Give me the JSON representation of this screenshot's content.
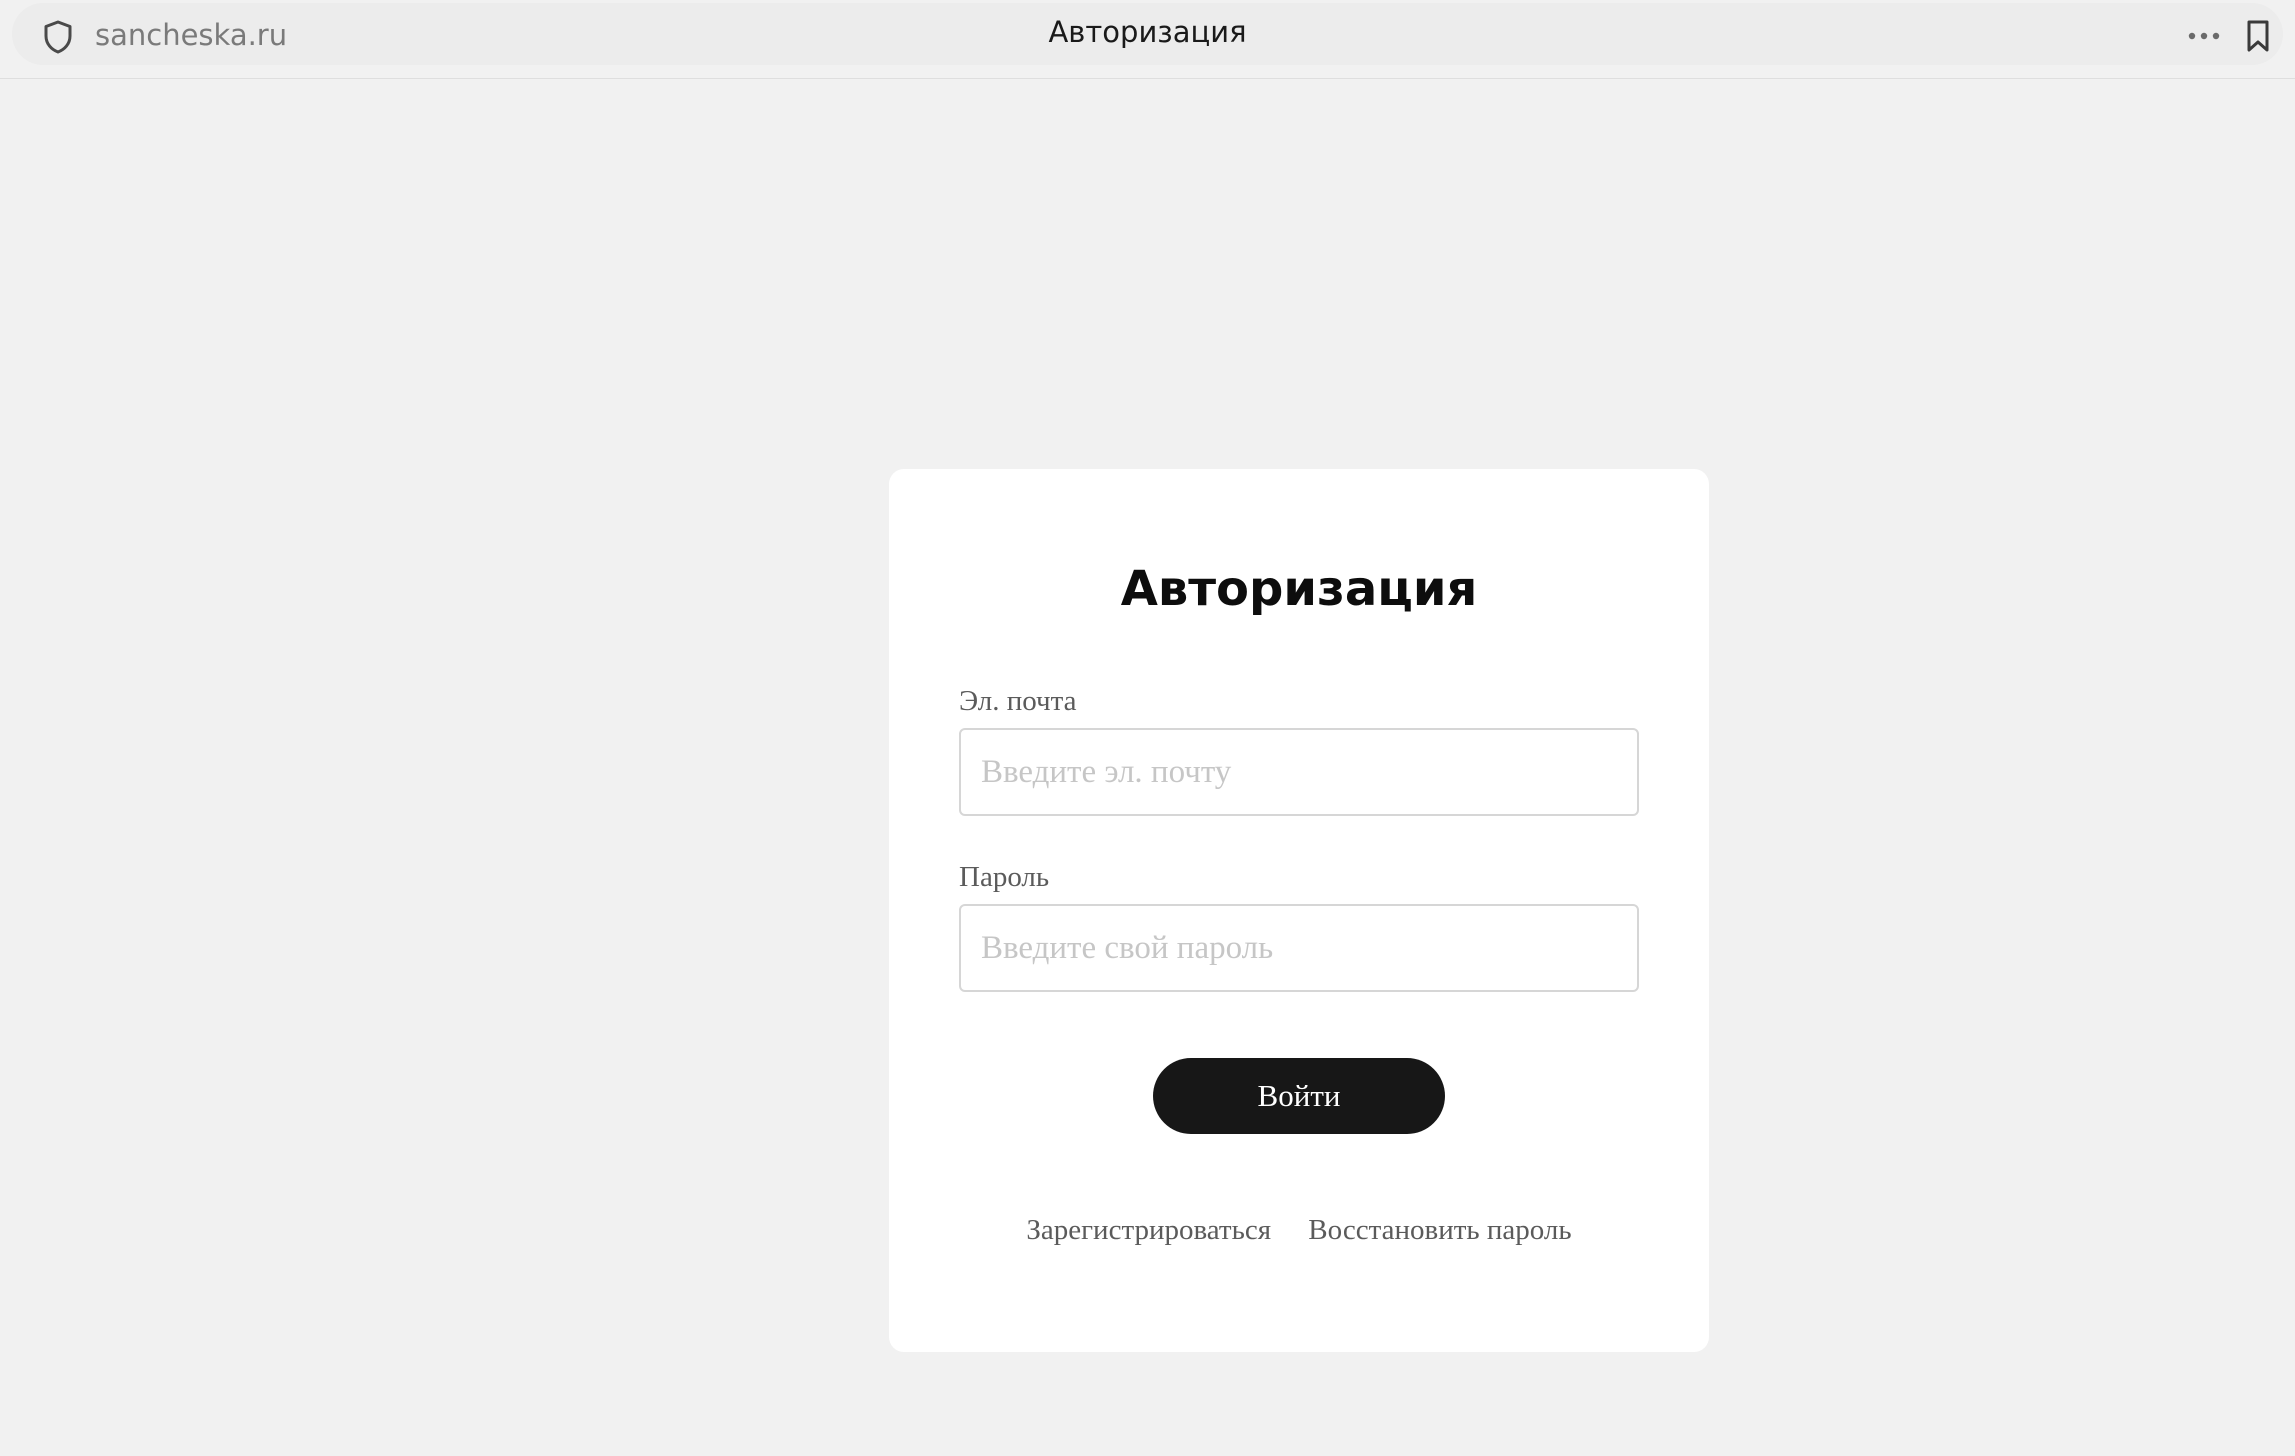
{
  "browser": {
    "url": "sancheska.ru",
    "tab_title": "Авторизация"
  },
  "icons": {
    "security": "shield-icon",
    "menu": "more-icon",
    "bookmark": "bookmark-icon"
  },
  "form": {
    "title": "Авторизация",
    "email": {
      "label": "Эл. почта",
      "value": "",
      "placeholder": "Введите эл. почту"
    },
    "password": {
      "label": "Пароль",
      "value": "",
      "placeholder": "Введите свой пароль"
    },
    "submit_label": "Войти",
    "links": {
      "register": "Зарегистрироваться",
      "restore": "Восстановить пароль"
    }
  },
  "colors": {
    "page_background": "#f1f1f1",
    "card_background": "#ffffff",
    "button_background": "#171717",
    "button_text": "#ffffff",
    "label_text": "#5b5b5b",
    "placeholder_text": "#c6c6c6"
  }
}
